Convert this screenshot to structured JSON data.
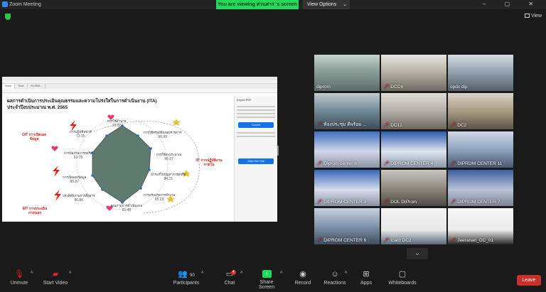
{
  "window": {
    "title": "Zoom Meeting",
    "controls": "– ▢ ✕"
  },
  "banner": {
    "text": "You are viewing ส่วนสาร 's screen"
  },
  "view_options": {
    "label": "View Options"
  },
  "view": {
    "label": "View"
  },
  "shared_screen": {
    "tabs": [
      "Home",
      "Tools",
      "ITA 2565..."
    ],
    "doc_title_line1": "ผลการดำเนินการประเมินคุณธรรมและความโปร่งใสในการดำเนินงาน (ITA)",
    "doc_title_line2": "ประจำปีงบประมาณ พ.ศ. 2565",
    "radar_labels": [
      {
        "t": "การใช้อำนาจ",
        "v": "91.82"
      },
      {
        "t": "การใช้ทรัพย์สินของราชการ",
        "v": "96.90"
      },
      {
        "t": "การใช้งบประมาณ",
        "v": "96.67"
      },
      {
        "t": "การแก้ไขปัญหาการทุจริต",
        "v": "84.15"
      },
      {
        "t": "การปรับปรุงการทำงาน",
        "v": "85.23"
      },
      {
        "t": "คุณภาพการดำเนินงาน",
        "v": "81.46"
      },
      {
        "t": "ประสิทธิภาพการสื่อสาร",
        "v": "86.84"
      },
      {
        "t": "การเปิดเผยข้อมูล",
        "v": "83.87"
      },
      {
        "t": "การป้องกันการทุจริต",
        "v": "93.78"
      },
      {
        "t": "การปฏิบัติหน้าที่",
        "v": "73.75"
      }
    ],
    "left_red_top": "OIT การเปิดเผยข้อมูล",
    "right_red": "IIT การปฏิบัติงานภายใน",
    "left_red_bottom": "EIT การประเมินภายนอก",
    "side_panel": {
      "head": "Export PDF",
      "button": "Convert",
      "button2": "Start Free Trial"
    }
  },
  "participants": [
    {
      "name": "diprom",
      "muted": false,
      "active": true
    },
    {
      "name": "DCC6",
      "muted": true
    },
    {
      "name": "opdc dip",
      "muted": false
    },
    {
      "name": "ห้องประชุม ดีพร้อม ...",
      "muted": true
    },
    {
      "name": "DC12",
      "muted": true
    },
    {
      "name": "DC2",
      "muted": true
    },
    {
      "name": "DIprom center 8",
      "muted": true
    },
    {
      "name": "DIPROM CENTER 4",
      "muted": true
    },
    {
      "name": "DIPROM CENTER 11",
      "muted": true
    },
    {
      "name": "DIPROM CENTER 3",
      "muted": true
    },
    {
      "name": "DOL DIProm",
      "muted": true
    },
    {
      "name": "DIPROM CENTER 7",
      "muted": true
    },
    {
      "name": "DIPROM CENTER 6",
      "muted": true
    },
    {
      "name": "Icard DC2",
      "muted": true
    },
    {
      "name": "Jeeranan_DC_01",
      "muted": true
    }
  ],
  "toolbar": {
    "unmute": "Unmute",
    "start_video": "Start Video",
    "participants": "Participants",
    "participants_count": "90",
    "chat": "Chat",
    "chat_badge": "4",
    "share": "Share Screen",
    "record": "Record",
    "reactions": "Reactions",
    "apps": "Apps",
    "whiteboards": "Whiteboards",
    "leave": "Leave"
  },
  "colors": {
    "share_green": "#23d959",
    "leave_red": "#c8312b",
    "active_outline": "#d6e34a",
    "mute_red": "#e22222"
  }
}
